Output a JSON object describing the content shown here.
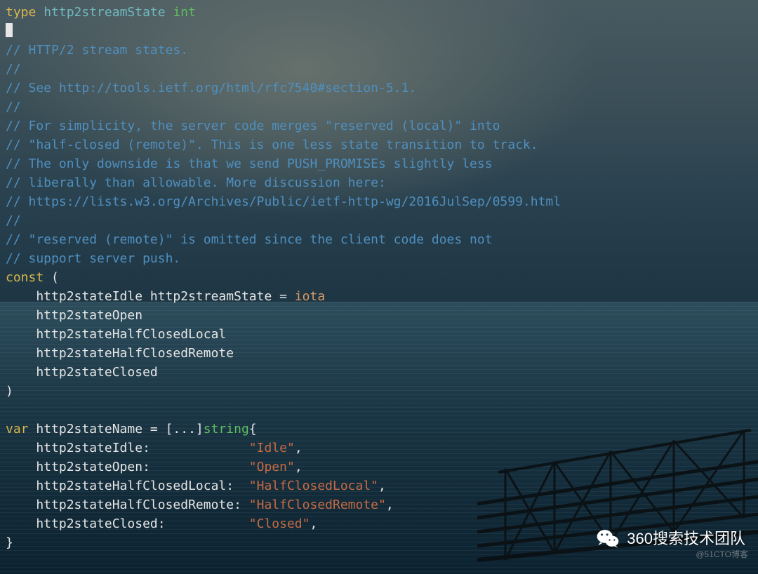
{
  "code": {
    "l1_type": "type",
    "l1_name": " http2streamState ",
    "l1_int": "int",
    "c_states": "// HTTP/2 stream states.",
    "c_slashes": "//",
    "c_see": "// See http://tools.ietf.org/html/rfc7540#section-5.1.",
    "c_for": "// For simplicity, the server code merges \"reserved (local)\" into",
    "c_half": "// \"half-closed (remote)\". This is one less state transition to track.",
    "c_only": "// The only downside is that we send PUSH_PROMISEs slightly less",
    "c_lib": "// liberally than allowable. More discussion here:",
    "c_url": "// https://lists.w3.org/Archives/Public/ietf-http-wg/2016JulSep/0599.html",
    "c_res": "// \"reserved (remote)\" is omitted since the client code does not",
    "c_sup": "// support server push.",
    "const": "const",
    "lparen": " (",
    "idle_decl": "    http2stateIdle http2streamState = ",
    "iota": "iota",
    "open_decl": "    http2stateOpen",
    "hcl_decl": "    http2stateHalfClosedLocal",
    "hcr_decl": "    http2stateHalfClosedRemote",
    "closed_decl": "    http2stateClosed",
    "rparen": ")",
    "var": "var",
    "var_name": " http2stateName = [...]",
    "string": "string",
    "lbrace": "{",
    "m_idle_k": "    http2stateIdle:             ",
    "m_idle_v": "\"Idle\"",
    "comma": ",",
    "m_open_k": "    http2stateOpen:             ",
    "m_open_v": "\"Open\"",
    "m_hcl_k": "    http2stateHalfClosedLocal:  ",
    "m_hcl_v": "\"HalfClosedLocal\"",
    "m_hcr_k": "    http2stateHalfClosedRemote: ",
    "m_hcr_v": "\"HalfClosedRemote\"",
    "m_closed_k": "    http2stateClosed:           ",
    "m_closed_v": "\"Closed\"",
    "rbrace": "}"
  },
  "watermark": {
    "text": "360搜索技术团队",
    "sub": "@51CTO博客"
  }
}
